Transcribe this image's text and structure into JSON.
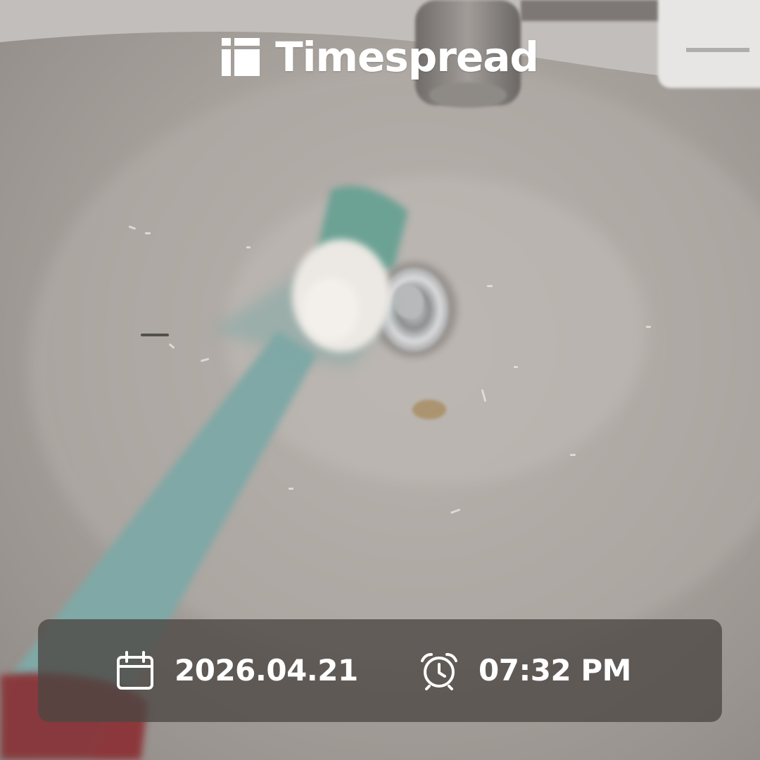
{
  "app": {
    "brand_name": "Timespread",
    "brand_icon": "timespread-logo-icon"
  },
  "stamp": {
    "date_icon": "calendar-icon",
    "date": "2026.04.21",
    "time_icon": "alarm-clock-icon",
    "time": "07:32 PM"
  },
  "colors": {
    "text": "#ffffff",
    "stamp_background": "#4c4642",
    "toothbrush_handle": "#7fa8a6",
    "sink": "#aaa49f"
  }
}
